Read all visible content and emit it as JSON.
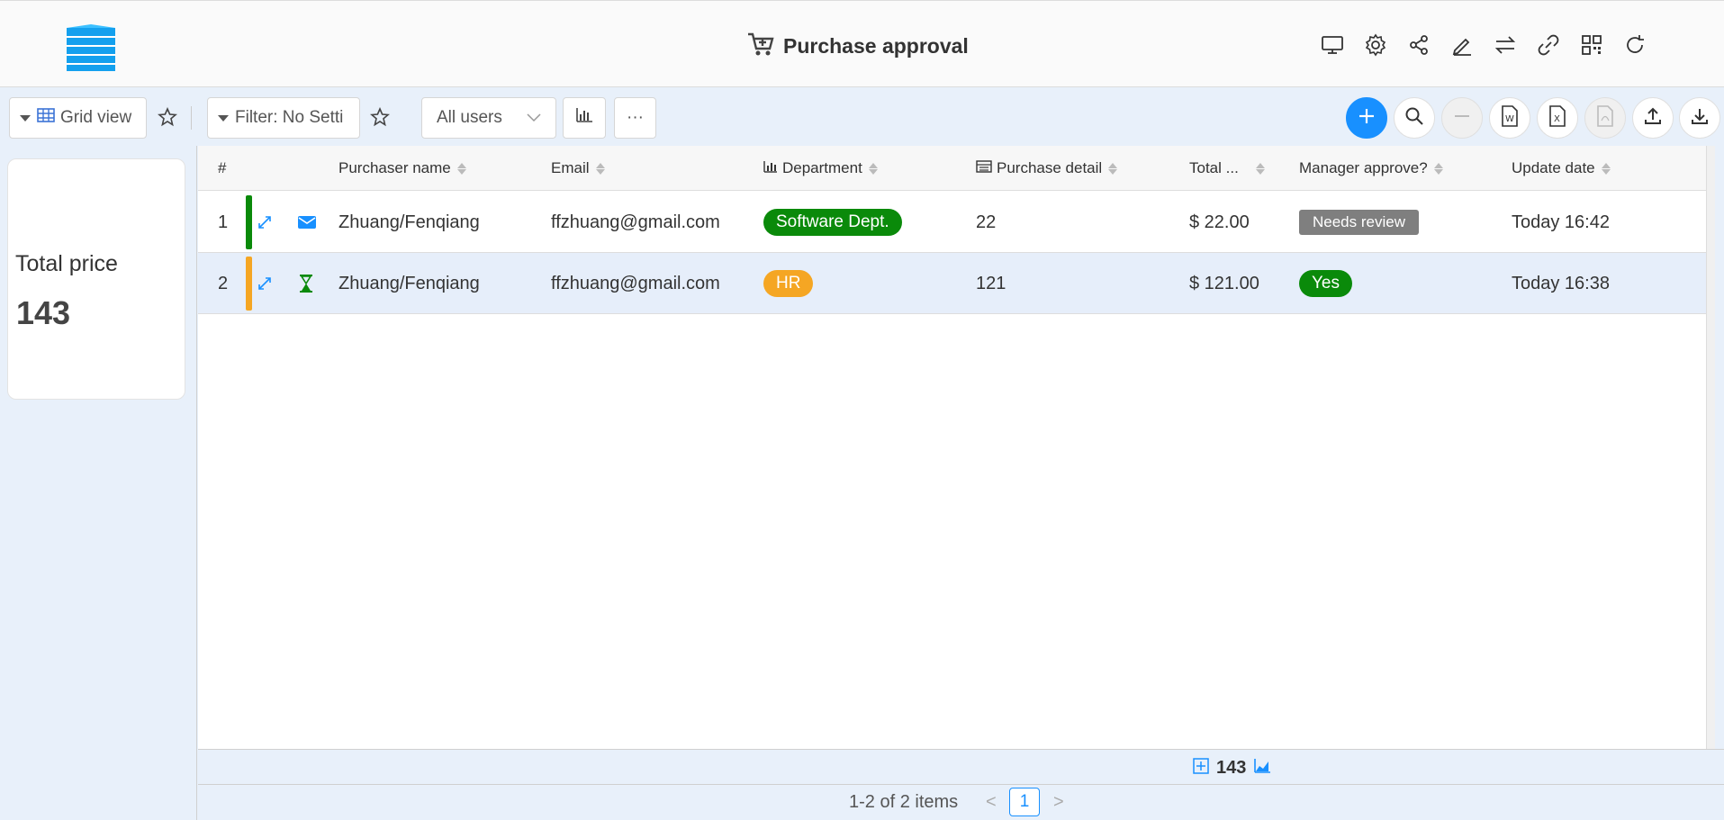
{
  "header": {
    "title": "Purchase approval",
    "icons": [
      "monitor-icon",
      "gear-icon",
      "share-icon",
      "edit-icon",
      "swap-icon",
      "link-icon",
      "qrcode-icon",
      "refresh-icon"
    ]
  },
  "toolbar": {
    "view_label": "Grid view",
    "filter_label": "Filter: No Setti",
    "users_select": "All users",
    "more_label": "···"
  },
  "stat": {
    "label": "Total price",
    "value": "143"
  },
  "table": {
    "columns": {
      "index": "#",
      "purchaser": "Purchaser name",
      "email": "Email",
      "department": "Department",
      "detail": "Purchase detail",
      "total": "Total ...",
      "manager": "Manager approve?",
      "updated": "Update date"
    },
    "rows": [
      {
        "index": "1",
        "status_color": "#0a8a0a",
        "status_icon": "envelope-icon",
        "purchaser": "Zhuang/Fenqiang",
        "email": "ffzhuang@gmail.com",
        "department": "Software Dept.",
        "department_color": "#0a8a0a",
        "detail": "22",
        "total": "$ 22.00",
        "manager": "Needs review",
        "manager_color": "#7f7f7f",
        "updated": "Today 16:42"
      },
      {
        "index": "2",
        "status_color": "#f5a623",
        "status_icon": "hourglass-icon",
        "purchaser": "Zhuang/Fenqiang",
        "email": "ffzhuang@gmail.com",
        "department": "HR",
        "department_color": "#f5a623",
        "detail": "121",
        "total": "$ 121.00",
        "manager": "Yes",
        "manager_color": "#0a8a0a",
        "updated": "Today 16:38"
      }
    ]
  },
  "summary": {
    "total": "143"
  },
  "pager": {
    "text": "1-2 of 2 items",
    "prev": "<",
    "page": "1",
    "next": ">"
  },
  "colors": {
    "primary": "#1890ff",
    "green": "#0a8a0a",
    "orange": "#f5a623"
  }
}
